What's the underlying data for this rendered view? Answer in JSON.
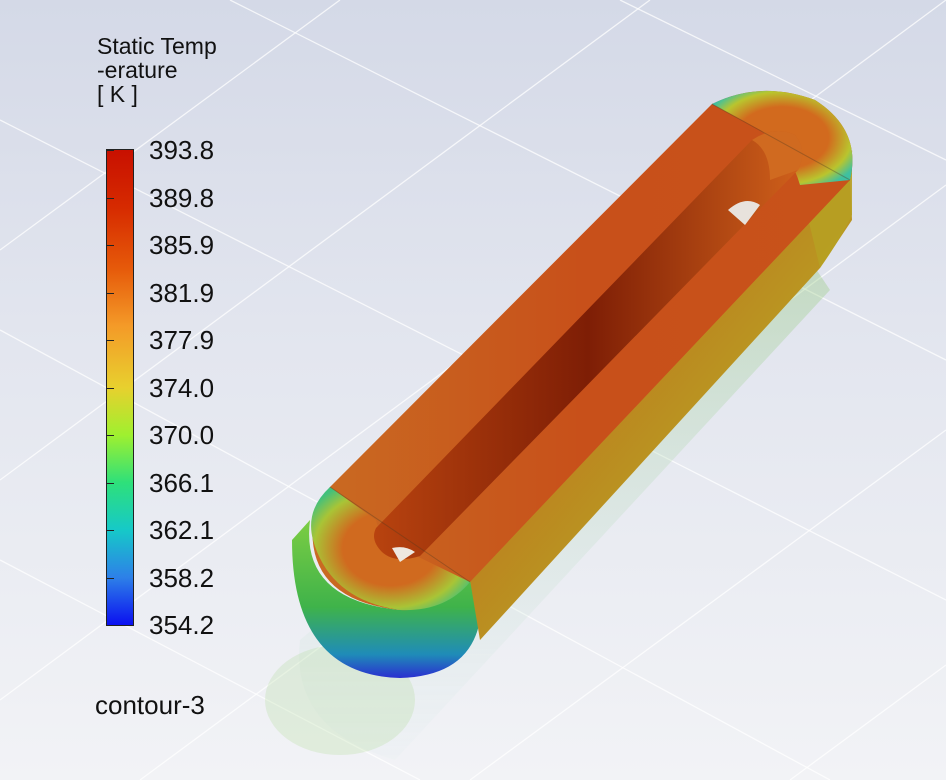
{
  "legend": {
    "title_line1": "Static Temp",
    "title_line2": "-erature",
    "units": "[ K ]",
    "ticks": [
      "393.8",
      "389.8",
      "385.9",
      "381.9",
      "377.9",
      "374.0",
      "370.0",
      "366.1",
      "362.1",
      "358.2",
      "354.2"
    ],
    "min": 354.2,
    "max": 393.8,
    "colormap": [
      "#c81000",
      "#e65a0a",
      "#f49a28",
      "#e8d02e",
      "#9ff02f",
      "#2ee07a",
      "#16c9c8",
      "#2d80e8",
      "#0b10f0"
    ]
  },
  "contour_name": "contour-3",
  "colors": {
    "background_top": "#d4d9e7",
    "background_bottom": "#f2f3f6",
    "surface_hot": "#c5470f",
    "surface_cool": "#5bbf3a"
  }
}
